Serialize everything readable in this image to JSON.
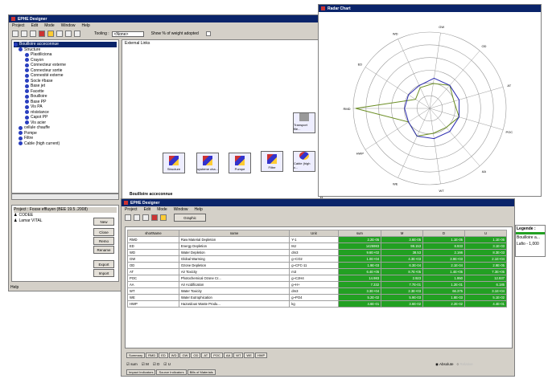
{
  "main": {
    "title": "EPHE Designer",
    "menu": [
      "Project",
      "Edit",
      "Mode",
      "Window",
      "Help"
    ],
    "tooling_label": "Tooling :",
    "tooling_value": "<None>",
    "show_label": "Show % of weight adopted",
    "tree_root": "Bouilloire acceconnue",
    "tree": [
      "Structure",
      "Plastiliciona",
      "Crayon",
      "Connecteur externe",
      "Connecteur sortie",
      "Connexité externe",
      "Socle #base",
      "Base jet",
      "Facette",
      "Bouilloire",
      "Base PP",
      "Vis PA",
      "résistance",
      "Capot PP",
      "Vis acier",
      "cellule chauffe",
      "Pompe",
      "Filtre",
      "Cable (high current)"
    ],
    "canvas_label": "External Links",
    "nodes": [
      "Structure",
      "systeme cha...",
      "Pompe",
      "Filtre",
      "Cable (high c...",
      "Transport file..."
    ],
    "status": "Bouilloire acceconnue",
    "save": "Save",
    "project_label": "Project : Fosse effluyen (BEE 19.5..2008)",
    "users": [
      "CODEE",
      "Lamar VITAL"
    ],
    "side_buttons": [
      "New",
      "Close",
      "Remo",
      "Rename",
      "Export",
      "Import"
    ],
    "help": "Help"
  },
  "radar": {
    "title": "Radar Chart"
  },
  "chart_data": {
    "type": "radar",
    "axes": [
      "RMD",
      "ED",
      "WD",
      "GW",
      "OD",
      "AT",
      "POC",
      "AA",
      "WT",
      "WE",
      "HWP"
    ],
    "series": [
      {
        "color": "#6b8e23",
        "values": [
          0.97,
          0.22,
          0.3,
          0.33,
          0.4,
          0.33,
          0.4,
          0.33,
          0.33,
          0.4,
          0.33
        ]
      },
      {
        "color": "#2a2ab0",
        "values": [
          0.33,
          0.33,
          0.33,
          0.4,
          0.4,
          0.4,
          0.4,
          0.4,
          0.4,
          0.4,
          0.33
        ]
      }
    ],
    "rings": 6
  },
  "designer2": {
    "title": "EPHE Designer",
    "menu": [
      "Project",
      "Edit",
      "Mode",
      "Window",
      "Help"
    ],
    "graphic": "Graphic",
    "headers": [
      "shortName",
      "name",
      "Unit",
      "sum",
      "M",
      "D",
      "U"
    ],
    "rows": [
      [
        "RMD",
        "Raw Material Depletion",
        "Y-1",
        "2.2E-05",
        "3.6E-05",
        "1.1E-05",
        "1.1E-06"
      ],
      [
        "ED",
        "Energy Depletion",
        "MJ",
        "1425983",
        "98.153",
        "8.933",
        "3.1E-03"
      ],
      [
        "WD",
        "Water Depletion",
        "dm3",
        "9.6E+02",
        "38.53",
        "2.166",
        "8.3E-03"
      ],
      [
        "GW",
        "Global Warming",
        "g~CO2",
        "1.0E+04",
        "4.3E+03",
        "3.9E+03",
        "2.1E+04"
      ],
      [
        "OD",
        "Ozone Depletion",
        "g~CFC-11",
        "1.9E-03",
        "6.3E-04",
        "2.1E-04",
        "2.9E-05"
      ],
      [
        "AT",
        "Air Toxicity",
        "m3",
        "6.4E+05",
        "8.7E+05",
        "1.4E+05",
        "7.3E+05"
      ],
      [
        "POC",
        "Photochemical Ozone Cr...",
        "g~C2H4",
        "14.983",
        "2.923",
        "1.950",
        "12.937"
      ],
      [
        "AA",
        "Air Acidification",
        "g~H+",
        "7.332",
        "7.7E-01",
        "1.2E-01",
        "6.185"
      ],
      [
        "WT",
        "Water Toxicity",
        "dm3",
        "3.3E+04",
        "2.3E+03",
        "66.375",
        "3.1E+04"
      ],
      [
        "WE",
        "Water Eutrophication",
        "g~PO4",
        "5.2E-02",
        "5.9E-03",
        "1.8E-03",
        "5.1E-02"
      ],
      [
        "HWP",
        "Hazardous Waste Produ...",
        "kg",
        "4.6E-01",
        "3.6E-02",
        "2.2E-02",
        "4.4E-01"
      ]
    ],
    "tabs": [
      "Summary",
      "RMD",
      "ED",
      "WD",
      "GW",
      "OD",
      "AT",
      "POC",
      "AA",
      "WT",
      "WE",
      "HWP"
    ],
    "checks": [
      "sum",
      "M",
      "D",
      "U"
    ],
    "radio_abs": "Absolute",
    "radio_rel": "Relative",
    "bottom_tabs": [
      "Impact Indicators",
      "Source Indicators",
      "Bills of Materials"
    ]
  },
  "legend": {
    "title": "Legende :",
    "items": [
      "Bouilloire a...",
      "Lafio - 1,000"
    ],
    "colors": [
      "#2a2ab0",
      "#6b8e23"
    ]
  }
}
